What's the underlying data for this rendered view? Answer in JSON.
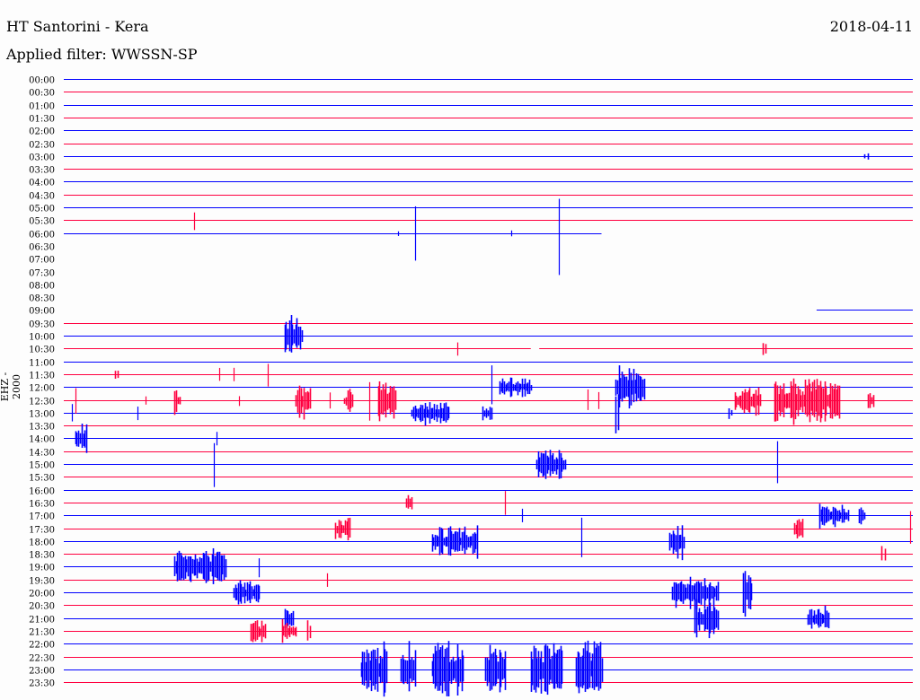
{
  "header": {
    "title": "HT Santorini - Kera",
    "date": "2018-04-11",
    "filter": "Applied filter: WWSSN-SP"
  },
  "chart_data": {
    "type": "helicorder",
    "title": "HT Santorini - Kera",
    "channel_label": "EHZ - 2000",
    "row_minutes": 30,
    "colors": {
      "even_row": "#0000ff",
      "odd_row": "#ff0040"
    },
    "row_labels": [
      "00:00",
      "00:30",
      "01:00",
      "01:30",
      "02:00",
      "02:30",
      "03:00",
      "03:30",
      "04:00",
      "04:30",
      "05:00",
      "05:30",
      "06:00",
      "06:30",
      "07:00",
      "07:30",
      "08:00",
      "08:30",
      "09:00",
      "09:30",
      "10:00",
      "10:30",
      "11:00",
      "11:30",
      "12:00",
      "12:30",
      "13:00",
      "13:30",
      "14:00",
      "14:30",
      "15:00",
      "15:30",
      "16:00",
      "16:30",
      "17:00",
      "17:30",
      "18:00",
      "18:30",
      "19:00",
      "19:30",
      "20:00",
      "20:30",
      "21:00",
      "21:30",
      "22:00",
      "22:30",
      "23:00",
      "23:30"
    ],
    "coverage": {
      "default": [
        0,
        30
      ],
      "12": [
        0,
        19
      ],
      "13": null,
      "14": null,
      "15": null,
      "16": null,
      "17": null,
      "18": [
        26.6,
        30
      ],
      "21": [
        [
          0,
          16.5
        ],
        [
          16.8,
          30
        ]
      ]
    },
    "events": [
      {
        "row": 6,
        "start": 28.3,
        "end": 28.4,
        "amp": 9
      },
      {
        "row": 11,
        "start": 4.6,
        "end": 4.6,
        "amp": 12
      },
      {
        "row": 12,
        "start": 11.8,
        "end": 11.8,
        "amp": 3
      },
      {
        "row": 12,
        "start": 12.4,
        "end": 12.4,
        "amp": 35
      },
      {
        "row": 12,
        "start": 15.8,
        "end": 15.8,
        "amp": 4
      },
      {
        "row": 12,
        "start": 17.5,
        "end": 17.5,
        "amp": 52
      },
      {
        "row": 20,
        "start": 7.8,
        "end": 8.4,
        "amp": 26
      },
      {
        "row": 21,
        "start": 13.9,
        "end": 13.9,
        "amp": 8
      },
      {
        "row": 21,
        "start": 24.7,
        "end": 24.8,
        "amp": 14
      },
      {
        "row": 23,
        "start": 1.8,
        "end": 1.9,
        "amp": 10
      },
      {
        "row": 23,
        "start": 5.5,
        "end": 5.5,
        "amp": 8
      },
      {
        "row": 23,
        "start": 6.0,
        "end": 6.0,
        "amp": 9
      },
      {
        "row": 23,
        "start": 7.2,
        "end": 7.2,
        "amp": 15
      },
      {
        "row": 24,
        "start": 15.1,
        "end": 15.1,
        "amp": 25
      },
      {
        "row": 24,
        "start": 15.4,
        "end": 16.5,
        "amp": 12
      },
      {
        "row": 24,
        "start": 19.5,
        "end": 20.5,
        "amp": 25
      },
      {
        "row": 25,
        "start": 0.4,
        "end": 0.4,
        "amp": 15
      },
      {
        "row": 25,
        "start": 2.9,
        "end": 2.9,
        "amp": 5
      },
      {
        "row": 25,
        "start": 3.9,
        "end": 4.1,
        "amp": 18
      },
      {
        "row": 25,
        "start": 6.2,
        "end": 6.2,
        "amp": 6
      },
      {
        "row": 25,
        "start": 8.2,
        "end": 8.7,
        "amp": 22
      },
      {
        "row": 25,
        "start": 9.4,
        "end": 9.4,
        "amp": 12
      },
      {
        "row": 25,
        "start": 9.9,
        "end": 10.2,
        "amp": 15
      },
      {
        "row": 25,
        "start": 10.8,
        "end": 10.8,
        "amp": 25
      },
      {
        "row": 25,
        "start": 11.1,
        "end": 11.7,
        "amp": 25
      },
      {
        "row": 25,
        "start": 18.5,
        "end": 18.5,
        "amp": 15
      },
      {
        "row": 25,
        "start": 18.9,
        "end": 18.9,
        "amp": 10
      },
      {
        "row": 25,
        "start": 23.7,
        "end": 24.6,
        "amp": 20
      },
      {
        "row": 25,
        "start": 25.1,
        "end": 27.4,
        "amp": 28
      },
      {
        "row": 25,
        "start": 28.4,
        "end": 28.6,
        "amp": 14
      },
      {
        "row": 26,
        "start": 0.3,
        "end": 0.3,
        "amp": 12
      },
      {
        "row": 26,
        "start": 2.6,
        "end": 2.6,
        "amp": 10
      },
      {
        "row": 26,
        "start": 12.3,
        "end": 13.6,
        "amp": 15
      },
      {
        "row": 26,
        "start": 14.8,
        "end": 15.1,
        "amp": 12
      },
      {
        "row": 26,
        "start": 19.5,
        "end": 19.6,
        "amp": 25
      },
      {
        "row": 26,
        "start": 23.5,
        "end": 23.6,
        "amp": 12
      },
      {
        "row": 28,
        "start": 0.4,
        "end": 0.8,
        "amp": 20
      },
      {
        "row": 28,
        "start": 5.4,
        "end": 5.4,
        "amp": 12
      },
      {
        "row": 30,
        "start": 5.3,
        "end": 5.3,
        "amp": 28
      },
      {
        "row": 30,
        "start": 16.7,
        "end": 17.7,
        "amp": 20
      },
      {
        "row": 30,
        "start": 25.2,
        "end": 25.2,
        "amp": 30
      },
      {
        "row": 33,
        "start": 12.1,
        "end": 12.3,
        "amp": 12
      },
      {
        "row": 33,
        "start": 15.6,
        "end": 15.6,
        "amp": 14
      },
      {
        "row": 34,
        "start": 16.2,
        "end": 16.2,
        "amp": 10
      },
      {
        "row": 34,
        "start": 26.7,
        "end": 27.7,
        "amp": 15
      },
      {
        "row": 34,
        "start": 28.1,
        "end": 28.3,
        "amp": 16
      },
      {
        "row": 35,
        "start": 9.6,
        "end": 10.1,
        "amp": 15
      },
      {
        "row": 35,
        "start": 25.8,
        "end": 26.1,
        "amp": 15
      },
      {
        "row": 35,
        "start": 29.9,
        "end": 29.9,
        "amp": 22
      },
      {
        "row": 36,
        "start": 13.0,
        "end": 14.6,
        "amp": 20
      },
      {
        "row": 36,
        "start": 18.3,
        "end": 18.3,
        "amp": 28
      },
      {
        "row": 36,
        "start": 21.4,
        "end": 21.9,
        "amp": 25
      },
      {
        "row": 37,
        "start": 28.9,
        "end": 29.0,
        "amp": 12
      },
      {
        "row": 38,
        "start": 3.9,
        "end": 5.7,
        "amp": 22
      },
      {
        "row": 38,
        "start": 6.9,
        "end": 6.9,
        "amp": 15
      },
      {
        "row": 39,
        "start": 9.3,
        "end": 9.3,
        "amp": 12
      },
      {
        "row": 40,
        "start": 6.0,
        "end": 6.9,
        "amp": 15
      },
      {
        "row": 40,
        "start": 21.5,
        "end": 23.1,
        "amp": 20
      },
      {
        "row": 40,
        "start": 24.0,
        "end": 24.3,
        "amp": 30
      },
      {
        "row": 42,
        "start": 7.8,
        "end": 8.1,
        "amp": 14
      },
      {
        "row": 42,
        "start": 22.3,
        "end": 23.1,
        "amp": 25
      },
      {
        "row": 42,
        "start": 26.3,
        "end": 27.0,
        "amp": 15
      },
      {
        "row": 43,
        "start": 6.6,
        "end": 7.1,
        "amp": 14
      },
      {
        "row": 43,
        "start": 7.7,
        "end": 8.2,
        "amp": 14
      },
      {
        "row": 43,
        "start": 8.6,
        "end": 8.7,
        "amp": 18
      },
      {
        "row": 46,
        "start": 10.5,
        "end": 11.4,
        "amp": 35
      },
      {
        "row": 46,
        "start": 11.9,
        "end": 12.4,
        "amp": 35
      },
      {
        "row": 46,
        "start": 13.0,
        "end": 14.1,
        "amp": 35
      },
      {
        "row": 46,
        "start": 14.9,
        "end": 15.6,
        "amp": 30
      },
      {
        "row": 46,
        "start": 16.5,
        "end": 17.6,
        "amp": 35
      },
      {
        "row": 46,
        "start": 18.1,
        "end": 19.0,
        "amp": 35
      }
    ]
  }
}
